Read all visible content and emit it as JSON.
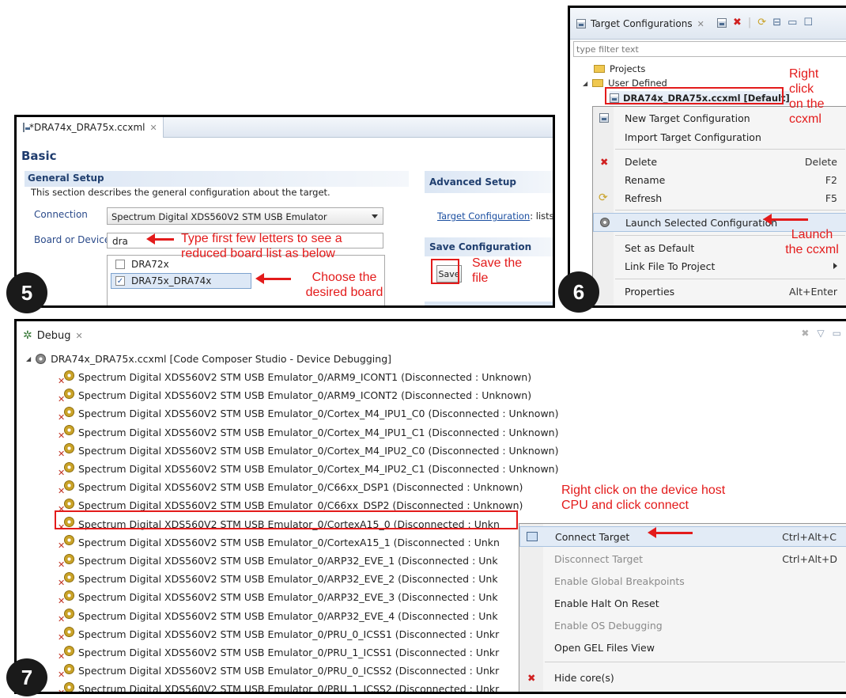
{
  "panel5": {
    "tab_title": "*DRA74x_DRA75x.ccxml",
    "basic_heading": "Basic",
    "general_setup_title": "General Setup",
    "general_setup_desc": "This section describes the general configuration about the target.",
    "connection_label": "Connection",
    "connection_value": "Spectrum Digital XDS560V2 STM USB Emulator",
    "board_label": "Board or Device",
    "board_value": "dra",
    "board_options": [
      {
        "label": "DRA72x",
        "checked": false
      },
      {
        "label": "DRA75x_DRA74x",
        "checked": true
      }
    ],
    "advanced_setup_title": "Advanced Setup",
    "target_config_link": "Target Configuration",
    "target_config_rest": ": lists t",
    "save_config_title": "Save Configuration",
    "save_button": "Save"
  },
  "panel6": {
    "tab_title": "Target Configurations",
    "filter_placeholder": "type filter text",
    "tree": {
      "projects": "Projects",
      "user_defined": "User Defined",
      "selected_file": "DRA74x_DRA75x.ccxml [Default]"
    },
    "menu": [
      {
        "label": "New Target Configuration",
        "shortcut": ""
      },
      {
        "label": "Import Target Configuration",
        "shortcut": ""
      },
      {
        "label": "Delete",
        "shortcut": "Delete"
      },
      {
        "label": "Rename",
        "shortcut": "F2"
      },
      {
        "label": "Refresh",
        "shortcut": "F5"
      },
      {
        "label": "Launch Selected Configuration",
        "shortcut": ""
      },
      {
        "label": "Set as Default",
        "shortcut": ""
      },
      {
        "label": "Link File To Project",
        "shortcut": ""
      },
      {
        "label": "Properties",
        "shortcut": "Alt+Enter"
      }
    ]
  },
  "panel7": {
    "tab_title": "Debug",
    "root_node": "DRA74x_DRA75x.ccxml [Code Composer Studio - Device Debugging]",
    "devices": [
      "Spectrum Digital XDS560V2 STM USB Emulator_0/ARM9_ICONT1 (Disconnected : Unknown)",
      "Spectrum Digital XDS560V2 STM USB Emulator_0/ARM9_ICONT2 (Disconnected : Unknown)",
      "Spectrum Digital XDS560V2 STM USB Emulator_0/Cortex_M4_IPU1_C0 (Disconnected : Unknown)",
      "Spectrum Digital XDS560V2 STM USB Emulator_0/Cortex_M4_IPU1_C1 (Disconnected : Unknown)",
      "Spectrum Digital XDS560V2 STM USB Emulator_0/Cortex_M4_IPU2_C0 (Disconnected : Unknown)",
      "Spectrum Digital XDS560V2 STM USB Emulator_0/Cortex_M4_IPU2_C1 (Disconnected : Unknown)",
      "Spectrum Digital XDS560V2 STM USB Emulator_0/C66xx_DSP1 (Disconnected : Unknown)",
      "Spectrum Digital XDS560V2 STM USB Emulator_0/C66xx_DSP2 (Disconnected : Unknown)",
      "Spectrum Digital XDS560V2 STM USB Emulator_0/CortexA15_0 (Disconnected : Unkn",
      "Spectrum Digital XDS560V2 STM USB Emulator_0/CortexA15_1 (Disconnected : Unkn",
      "Spectrum Digital XDS560V2 STM USB Emulator_0/ARP32_EVE_1 (Disconnected : Unk",
      "Spectrum Digital XDS560V2 STM USB Emulator_0/ARP32_EVE_2 (Disconnected : Unk",
      "Spectrum Digital XDS560V2 STM USB Emulator_0/ARP32_EVE_3 (Disconnected : Unk",
      "Spectrum Digital XDS560V2 STM USB Emulator_0/ARP32_EVE_4 (Disconnected : Unk",
      "Spectrum Digital XDS560V2 STM USB Emulator_0/PRU_0_ICSS1 (Disconnected : Unkr",
      "Spectrum Digital XDS560V2 STM USB Emulator_0/PRU_1_ICSS1 (Disconnected : Unkr",
      "Spectrum Digital XDS560V2 STM USB Emulator_0/PRU_0_ICSS2 (Disconnected : Unkr",
      "Spectrum Digital XDS560V2 STM USB Emulator_0/PRU_1_ICSS2 (Disconnected : Unkr"
    ],
    "menu": [
      {
        "label": "Connect Target",
        "shortcut": "Ctrl+Alt+C"
      },
      {
        "label": "Disconnect Target",
        "shortcut": "Ctrl+Alt+D"
      },
      {
        "label": "Enable Global Breakpoints",
        "shortcut": ""
      },
      {
        "label": "Enable Halt On Reset",
        "shortcut": ""
      },
      {
        "label": "Enable OS Debugging",
        "shortcut": ""
      },
      {
        "label": "Open GEL Files View",
        "shortcut": ""
      },
      {
        "label": "Hide core(s)",
        "shortcut": ""
      }
    ]
  },
  "annotations": {
    "type_letters": "Type first few letters to see a\nreduced board list as below",
    "choose_board": "Choose the\ndesired board",
    "save_file": "Save the\nfile",
    "right_click_ccxml": "Right\nclick\non the\nccxml",
    "launch_ccxml": "Launch\nthe ccxml",
    "right_click_device": "Right click on the device host\nCPU and click connect"
  },
  "steps": [
    "5",
    "6",
    "7"
  ],
  "colors": {
    "annotation": "#e31b1b",
    "section_title": "#203f6f",
    "link": "#1a4ea0"
  }
}
